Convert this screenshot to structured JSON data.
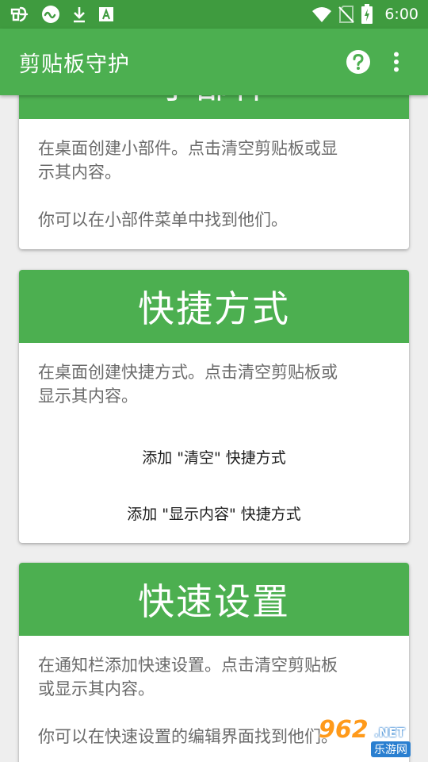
{
  "status_bar": {
    "time": "6:00",
    "icons_left": [
      "bug-icon",
      "cc-loop-icon",
      "download-icon",
      "accessibility-a-icon"
    ],
    "icons_right": [
      "wifi-icon",
      "no-sim-icon",
      "battery-charging-icon"
    ]
  },
  "app_bar": {
    "title": "剪贴板守护",
    "help_icon": "help-circle-icon",
    "menu_icon": "more-vert-icon"
  },
  "cards": {
    "widgets": {
      "title": "小部件",
      "line1": "在桌面创建小部件。点击清空剪贴板或显",
      "line2": "示其内容。",
      "line3": "你可以在小部件菜单中找到他们。"
    },
    "shortcuts": {
      "title": "快捷方式",
      "line1": "在桌面创建快捷方式。点击清空剪贴板或",
      "line2": "显示其内容。",
      "action_clear": "添加 \"清空\" 快捷方式",
      "action_show": "添加 \"显示内容\" 快捷方式"
    },
    "quick_settings": {
      "title": "快速设置",
      "line1": "在通知栏添加快速设置。点击清空剪贴板",
      "line2": "或显示其内容。",
      "line3": "你可以在快速设置的编辑界面找到他们。"
    }
  },
  "watermark": {
    "number": "962",
    "suffix": ".NET",
    "subtitle": "乐游网"
  },
  "colors": {
    "status_bar": "#3f9b3f",
    "primary": "#4caf50",
    "background": "#eeeeee",
    "body_text": "#6b6b6b",
    "action_text": "#1e1e1e"
  }
}
